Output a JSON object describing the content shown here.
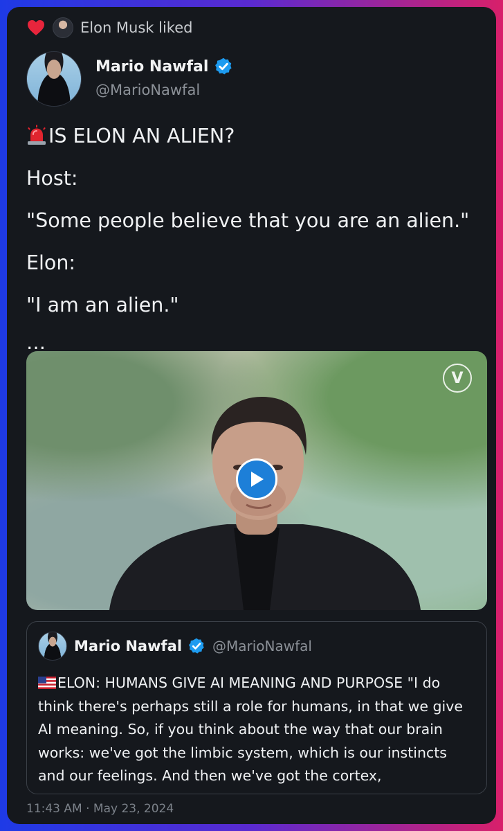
{
  "social_context": {
    "icon": "heart-icon",
    "text": "Elon Musk liked"
  },
  "author": {
    "display_name": "Mario Nawfal",
    "handle": "@MarioNawfal",
    "verified_icon": "verified-badge-icon"
  },
  "tweet": {
    "lines": [
      "IS ELON AN ALIEN?",
      "Host:",
      "\"Some people believe that you are an alien.\"",
      "Elon:",
      "\"I am an alien.\""
    ],
    "leading_icon": "siren-icon",
    "truncation": "…"
  },
  "video": {
    "badge_letter": "V",
    "play_icon": "play-icon"
  },
  "quoted_tweet": {
    "display_name": "Mario Nawfal",
    "handle": "@MarioNawfal",
    "flag_icon": "us-flag-icon",
    "lines": [
      "ELON: HUMANS GIVE AI MEANING AND PURPOSE \"I do",
      "think there's perhaps still a role for humans, in that we give",
      "AI meaning. So, if you think about the way that our brain",
      "works: we've got the limbic system, which is our instincts",
      "and our feelings. And then we've got the cortex,"
    ]
  },
  "timestamp": "11:43 AM · May 23, 2024",
  "colors": {
    "card_background": "#15181d",
    "accent_blue": "#1d9bf0",
    "heart_red": "#f91880",
    "muted_text": "#8b9097"
  }
}
